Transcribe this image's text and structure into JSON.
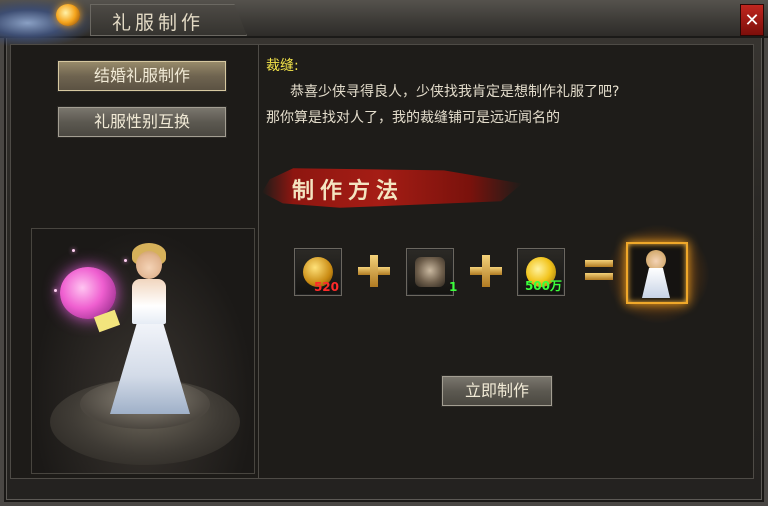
{
  "window": {
    "title": "礼服制作",
    "close_symbol": "✕"
  },
  "menu": {
    "items": [
      {
        "label": "结婚礼服制作",
        "selected": true
      },
      {
        "label": "礼服性别互换",
        "selected": false
      }
    ]
  },
  "npc": {
    "name": "裁缝:",
    "lines": [
      "恭喜少侠寻得良人，少侠找我肯定是想制作礼服了吧?",
      "那你算是找对人了，我的裁缝铺可是远近闻名的"
    ]
  },
  "recipe": {
    "title": "制作方法",
    "materials": [
      {
        "icon": "golden-bug-icon",
        "count": "520",
        "count_color": "#ff2a2a"
      },
      {
        "icon": "ore-bundle-icon",
        "count": "1",
        "count_color": "#3cff3c"
      },
      {
        "icon": "gold-coins-icon",
        "count": "500万",
        "count_color": "#3cff3c"
      }
    ],
    "result_icon": "wedding-dress-icon"
  },
  "actions": {
    "make_label": "立即制作"
  },
  "colors": {
    "npc_name": "#f5e64a",
    "dialog_text": "#e4ddcc",
    "banner_red": "#a51d15",
    "plus_gold": "#f4d27a"
  }
}
